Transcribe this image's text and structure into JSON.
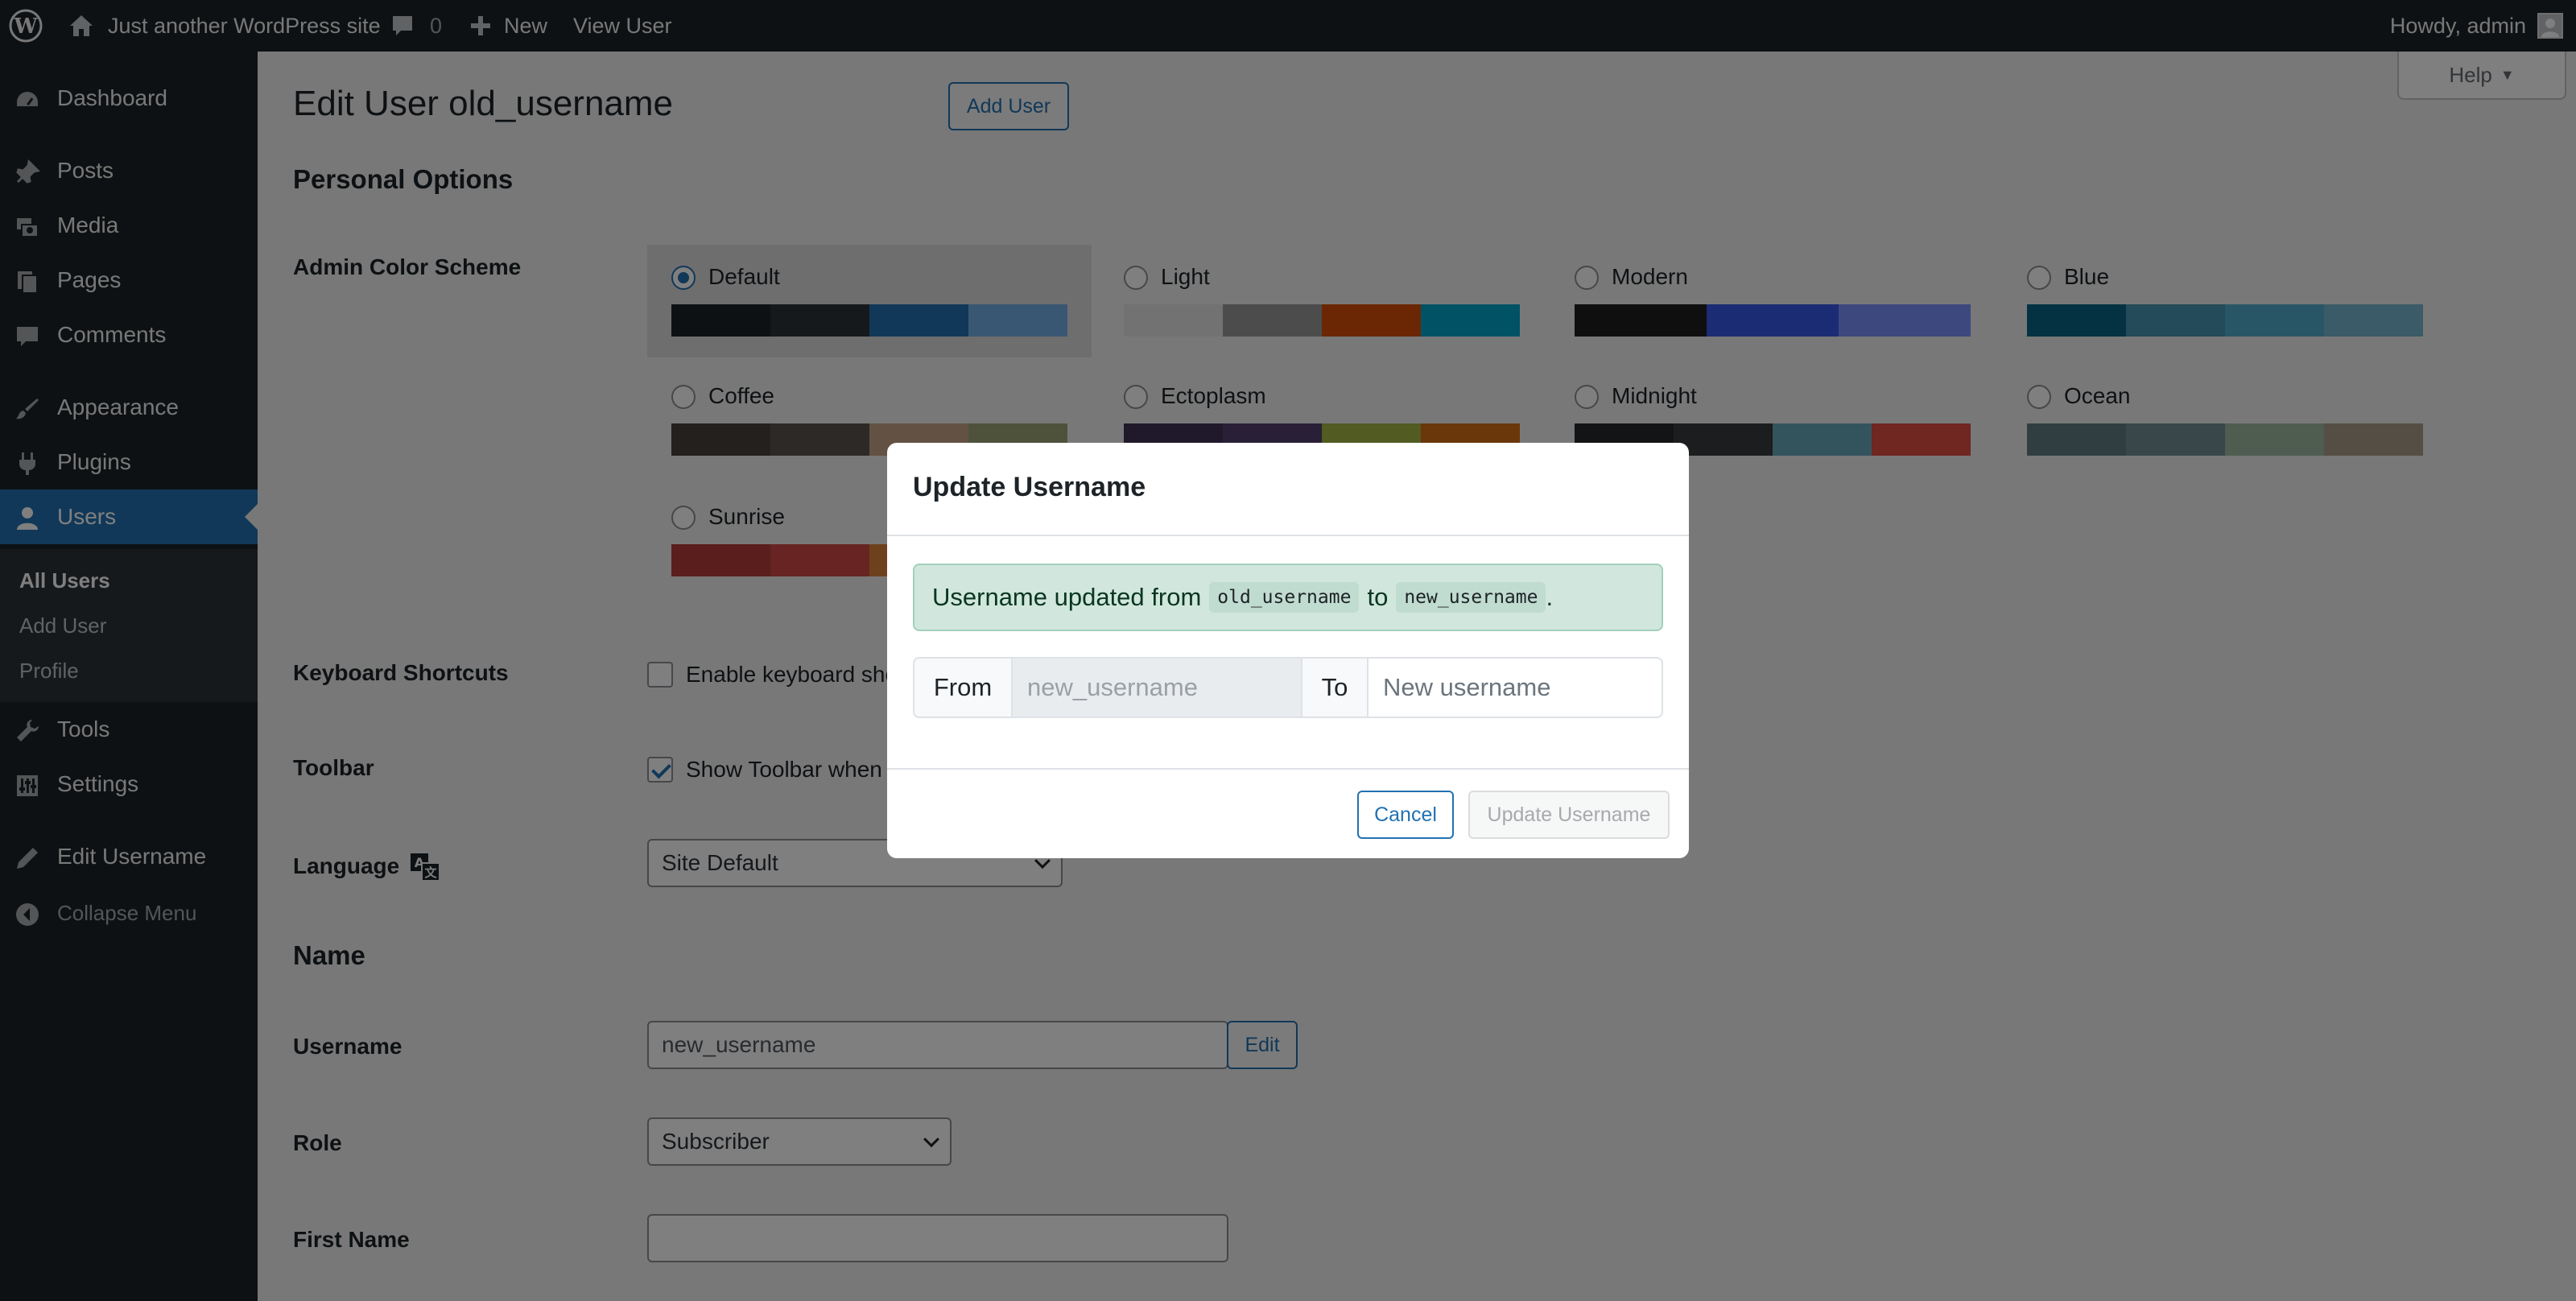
{
  "adminbar": {
    "site_name": "Just another WordPress site",
    "comments_count": "0",
    "new_label": "New",
    "view_user_label": "View User",
    "howdy": "Howdy, admin"
  },
  "sidebar": {
    "items": {
      "dashboard": "Dashboard",
      "posts": "Posts",
      "media": "Media",
      "pages": "Pages",
      "comments": "Comments",
      "appearance": "Appearance",
      "plugins": "Plugins",
      "users": "Users",
      "tools": "Tools",
      "settings": "Settings",
      "edit_username": "Edit Username",
      "collapse": "Collapse Menu"
    },
    "submenu": {
      "all_users": "All Users",
      "add_user": "Add User",
      "profile": "Profile"
    }
  },
  "main": {
    "title": "Edit User old_username",
    "add_user_button": "Add User",
    "help_label": "Help",
    "personal_options": "Personal Options",
    "admin_color_scheme_label": "Admin Color Scheme",
    "color_schemes": [
      {
        "name": "Default",
        "selected": true,
        "colors": [
          "#1d2327",
          "#2c3338",
          "#2271b1",
          "#72aee6"
        ]
      },
      {
        "name": "Light",
        "selected": false,
        "colors": [
          "#e5e5e5",
          "#999999",
          "#d64e07",
          "#04a4cc"
        ]
      },
      {
        "name": "Modern",
        "selected": false,
        "colors": [
          "#1e1e1e",
          "#3858e9",
          "#7b90ff"
        ]
      },
      {
        "name": "Blue",
        "selected": false,
        "colors": [
          "#096484",
          "#4796b3",
          "#52accc",
          "#74b6ce"
        ]
      },
      {
        "name": "Coffee",
        "selected": false,
        "colors": [
          "#46403c",
          "#59524c",
          "#c7a589",
          "#9ea476"
        ]
      },
      {
        "name": "Ectoplasm",
        "selected": false,
        "colors": [
          "#413256",
          "#523f6d",
          "#a3b745",
          "#d46f15"
        ]
      },
      {
        "name": "Midnight",
        "selected": false,
        "colors": [
          "#25282b",
          "#363b3f",
          "#69a8bb",
          "#e14d43"
        ]
      },
      {
        "name": "Ocean",
        "selected": false,
        "colors": [
          "#627c83",
          "#738e96",
          "#9ebaa0",
          "#aa9d88"
        ]
      },
      {
        "name": "Sunrise",
        "selected": false,
        "colors": [
          "#b43c38",
          "#cf4944",
          "#dd823b",
          "#ccaf0b"
        ]
      }
    ],
    "keyboard_shortcuts_label": "Keyboard Shortcuts",
    "keyboard_shortcuts_text": "Enable keyboard shortcuts for comment moderation.",
    "toolbar_label": "Toolbar",
    "toolbar_text": "Show Toolbar when viewing site",
    "language_label": "Language",
    "language_value": "Site Default",
    "name_section": "Name",
    "username_label": "Username",
    "username_value": "new_username",
    "edit_button": "Edit",
    "role_label": "Role",
    "role_value": "Subscriber",
    "first_name_label": "First Name",
    "first_name_value": ""
  },
  "modal": {
    "title": "Update Username",
    "alert_prefix": "Username updated from",
    "alert_old": "old_username",
    "alert_to": "to",
    "alert_new": "new_username",
    "alert_suffix": ".",
    "from_label": "From",
    "from_value": "new_username",
    "to_label": "To",
    "to_placeholder": "New username",
    "cancel_label": "Cancel",
    "update_label": "Update Username"
  },
  "colors": {
    "accent": "#2271b1",
    "adminbar_bg": "#1d2327",
    "alert_bg": "#d1e7dd"
  }
}
